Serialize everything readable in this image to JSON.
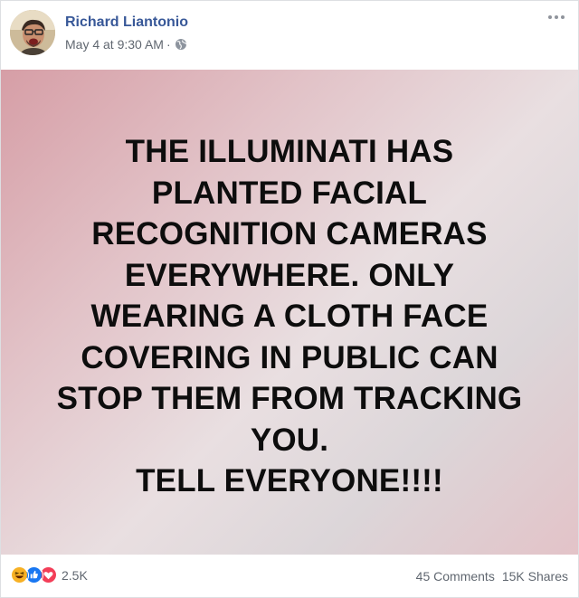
{
  "post": {
    "author": "Richard Liantonio",
    "timestamp": "May 4 at 9:30 AM",
    "separator": "·",
    "privacy_icon": "globe-icon",
    "more_icon": "more-options-icon"
  },
  "media": {
    "lines": [
      "THE ILLUMINATI HAS",
      "PLANTED FACIAL",
      "RECOGNITION CAMERAS",
      "EVERYWHERE. ONLY",
      "WEARING A CLOTH FACE",
      "COVERING IN PUBLIC CAN",
      "STOP THEM FROM TRACKING",
      "YOU.",
      "TELL EVERYONE!!!!"
    ]
  },
  "footer": {
    "reaction_icons": [
      "haha-icon",
      "like-icon",
      "love-icon"
    ],
    "reaction_count": "2.5K",
    "comments": "45 Comments",
    "shares": "15K Shares"
  },
  "colors": {
    "name_link": "#385898",
    "meta_text": "#606770",
    "like_blue": "#1877f2",
    "love_red": "#f33e58",
    "haha_yellow": "#f7b125"
  }
}
